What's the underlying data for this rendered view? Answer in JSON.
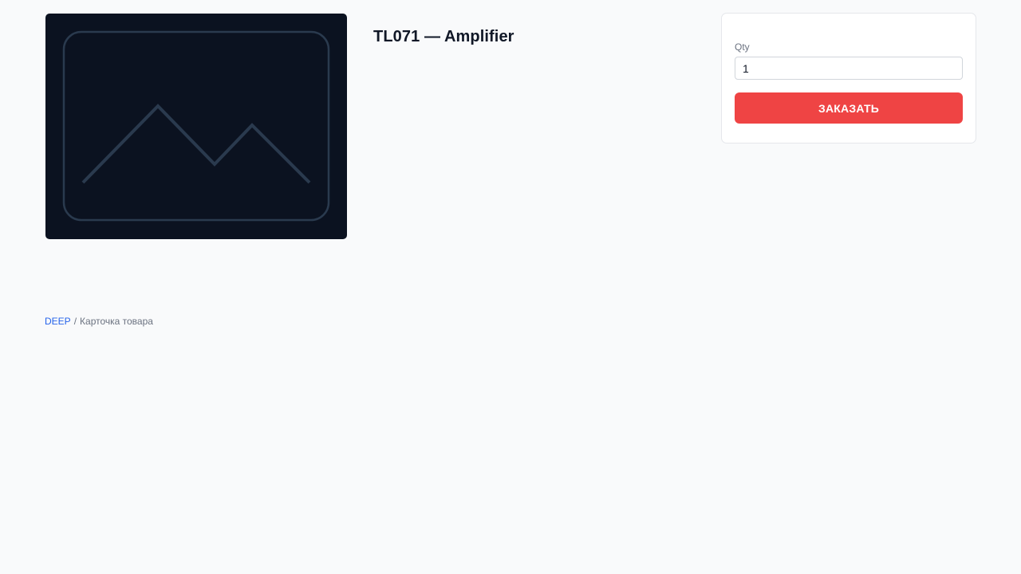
{
  "product": {
    "image_icon": "image-placeholder-icon",
    "title": "TL071 — Amplifier"
  },
  "order": {
    "qty_label": "Qty",
    "qty_value": "1",
    "button_label": "ЗАКАЗАТЬ",
    "button_color": "#ef4444"
  },
  "breadcrumb": {
    "home": "DEEP",
    "separator": "/",
    "current": "Карточка товара"
  }
}
